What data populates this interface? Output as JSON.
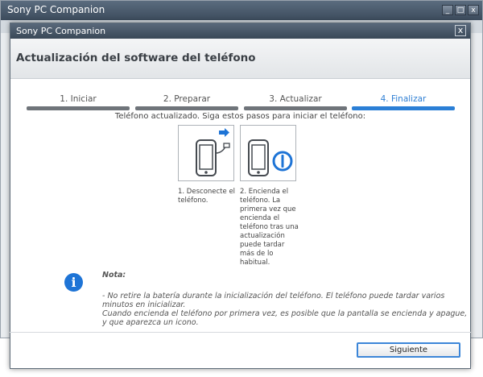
{
  "background_window": {
    "title": "Sony PC Companion",
    "controls": [
      "_",
      "□",
      "x"
    ]
  },
  "dialog": {
    "title": "Sony PC Companion",
    "close": "x",
    "heading": "Actualización del software del teléfono"
  },
  "steps": [
    {
      "label": "1. Iniciar",
      "active": false
    },
    {
      "label": "2. Preparar",
      "active": false
    },
    {
      "label": "3. Actualizar",
      "active": false
    },
    {
      "label": "4. Finalizar",
      "active": true
    }
  ],
  "instruction": "Teléfono actualizado. Siga estos pasos para iniciar el teléfono:",
  "instructions": [
    {
      "text": "1. Desconecte el teléfono.",
      "icon": "phone-disconnect-icon"
    },
    {
      "text": "2. Encienda el teléfono. La primera vez que encienda el teléfono tras una actualización puede tardar más de lo habitual.",
      "icon": "phone-power-icon"
    }
  ],
  "note": {
    "title": "Nota:",
    "lines": [
      "- No retire la batería durante la inicialización del teléfono. El teléfono puede tardar varios",
      "minutos en inicializar.",
      "Cuando encienda el teléfono por primera vez, es posible que la pantalla se encienda y apague,",
      "y que aparezca un icono."
    ]
  },
  "footer": {
    "next_label": "Siguiente"
  },
  "colors": {
    "accent": "#2b7fd6",
    "inactive_step": "#6f747a",
    "titlebar": "#3c4b5c"
  }
}
